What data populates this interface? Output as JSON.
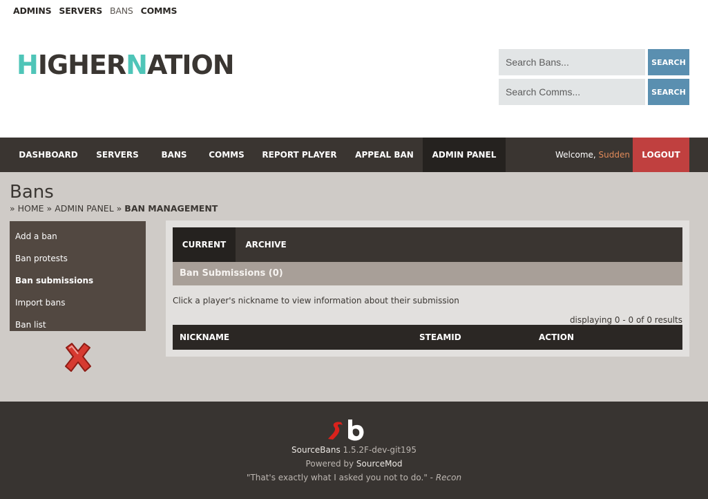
{
  "top_links": [
    "ADMINS",
    "SERVERS",
    "BANS",
    "COMMS"
  ],
  "logo": {
    "part1": "H",
    "part2": "IGHER",
    "part3": "N",
    "part4": "ATION"
  },
  "search": {
    "bans_placeholder": "Search Bans...",
    "comms_placeholder": "Search Comms...",
    "button_label": "SEARCH"
  },
  "nav": {
    "items": [
      "DASHBOARD",
      "SERVERS",
      "BANS",
      "COMMS",
      "REPORT PLAYER",
      "APPEAL BAN",
      "ADMIN PANEL"
    ],
    "welcome_prefix": "Welcome, ",
    "username": "Sudden",
    "logout": "LOGOUT"
  },
  "page": {
    "title": "Bans",
    "breadcrumb": [
      "HOME",
      "ADMIN PANEL",
      "BAN MANAGEMENT"
    ],
    "separator": "»"
  },
  "sidebar": {
    "items": [
      "Add a ban",
      "Ban protests",
      "Ban submissions",
      "Import bans",
      "Ban list"
    ]
  },
  "panel": {
    "tabs": [
      "CURRENT",
      "ARCHIVE"
    ],
    "subheading": "Ban Submissions (0)",
    "hint": "Click a player's nickname to view information about their submission",
    "displaying": "displaying 0 - 0 of 0 results",
    "columns": [
      "NICKNAME",
      "STEAMID",
      "ACTION"
    ]
  },
  "footer": {
    "product": "SourceBans",
    "version": " 1.5.2F-dev-git195",
    "powered_prefix": "Powered by ",
    "powered_by": "SourceMod",
    "quote": "\"That's exactly what I asked you not to do.\"",
    "quote_dash": " - ",
    "quote_author": "Recon"
  },
  "colors": {
    "nav_bg": "#3a3531",
    "accent_teal": "#4fc5b8",
    "search_button": "#5a8fb0",
    "logout": "#c0403f",
    "content_bg": "#cfcbc7",
    "username": "#e08a5a"
  },
  "icons": {
    "delete": "red-x-icon",
    "footer_logo": "sourcebans-logo"
  }
}
